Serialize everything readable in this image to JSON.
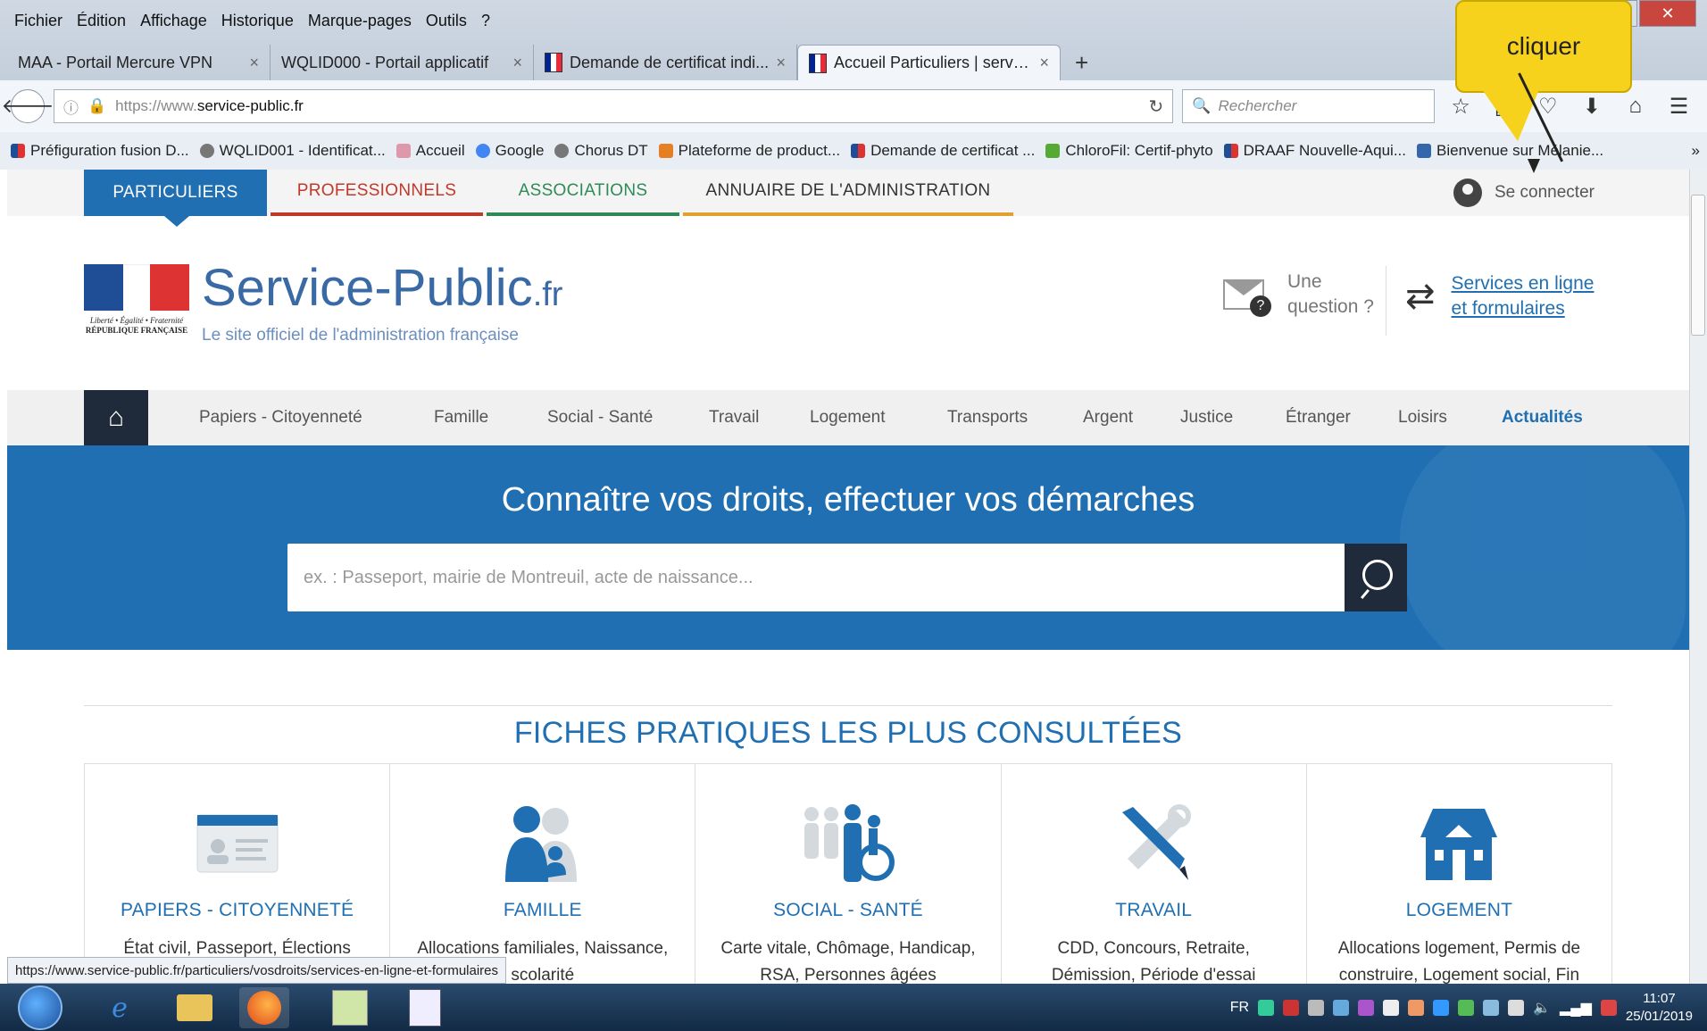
{
  "menubar": [
    "Fichier",
    "Édition",
    "Affichage",
    "Historique",
    "Marque-pages",
    "Outils",
    "?"
  ],
  "tabs": [
    {
      "label": "MAA - Portail Mercure VPN",
      "active": false
    },
    {
      "label": "WQLID000 - Portail applicatif",
      "active": false
    },
    {
      "label": "Demande de certificat indi...",
      "active": false
    },
    {
      "label": "Accueil Particuliers | servic...",
      "active": true
    }
  ],
  "new_tab": "+",
  "url": {
    "prefix": "https://www.",
    "domain": "service-public.fr"
  },
  "search_placeholder": "Rechercher",
  "bookmarks": [
    "Préfiguration fusion D...",
    "WQLID001 - Identificat...",
    "Accueil",
    "Google",
    "Chorus DT",
    "Plateforme de product...",
    "Demande de certificat ...",
    "ChloroFil: Certif-phyto",
    "DRAAF Nouvelle-Aqui...",
    "Bienvenue sur Mélanie..."
  ],
  "bookmarks_overflow": "»",
  "audience_tabs": [
    "PARTICULIERS",
    "PROFESSIONNELS",
    "ASSOCIATIONS",
    "ANNUAIRE DE L'ADMINISTRATION"
  ],
  "connect_label": "Se connecter",
  "logo": {
    "motto": "Liberté • Égalité • Fraternité",
    "republic": "RÉPUBLIQUE FRANÇAISE",
    "name": "Service-Public",
    "tld": ".fr",
    "tagline": "Le site officiel de l'administration française"
  },
  "question": {
    "line1": "Une",
    "line2": "question ?"
  },
  "services_link": {
    "line1": "Services en ligne",
    "line2": "et formulaires"
  },
  "nav": [
    "Papiers - Citoyenneté",
    "Famille",
    "Social - Santé",
    "Travail",
    "Logement",
    "Transports",
    "Argent",
    "Justice",
    "Étranger",
    "Loisirs",
    "Actualités"
  ],
  "hero": {
    "title": "Connaître vos droits, effectuer vos démarches",
    "placeholder": "ex. : Passeport, mairie de Montreuil, acte de naissance..."
  },
  "fiches_title": "FICHES PRATIQUES LES PLUS CONSULTÉES",
  "cards": [
    {
      "title": "PAPIERS - CITOYENNETÉ",
      "desc": "État civil, Passeport, Élections"
    },
    {
      "title": "FAMILLE",
      "desc": "Allocations familiales, Naissance, scolarité"
    },
    {
      "title": "SOCIAL - SANTÉ",
      "desc": "Carte vitale, Chômage, Handicap, RSA, Personnes âgées"
    },
    {
      "title": "TRAVAIL",
      "desc": "CDD, Concours, Retraite, Démission, Période d'essai"
    },
    {
      "title": "LOGEMENT",
      "desc": "Allocations logement, Permis de construire, Logement social, Fin"
    }
  ],
  "status_url": "https://www.service-public.fr/particuliers/vosdroits/services-en-ligne-et-formulaires",
  "callout": "cliquer",
  "tray": {
    "lang": "FR",
    "time": "11:07",
    "date": "25/01/2019"
  },
  "colors": {
    "brand_blue": "#1f6fb2",
    "dark_navy": "#1f2b3a",
    "pro_red": "#c0392b",
    "asso_green": "#2e8b57",
    "annuaire_gold": "#e0a130",
    "callout_yellow": "#f7d21c"
  }
}
